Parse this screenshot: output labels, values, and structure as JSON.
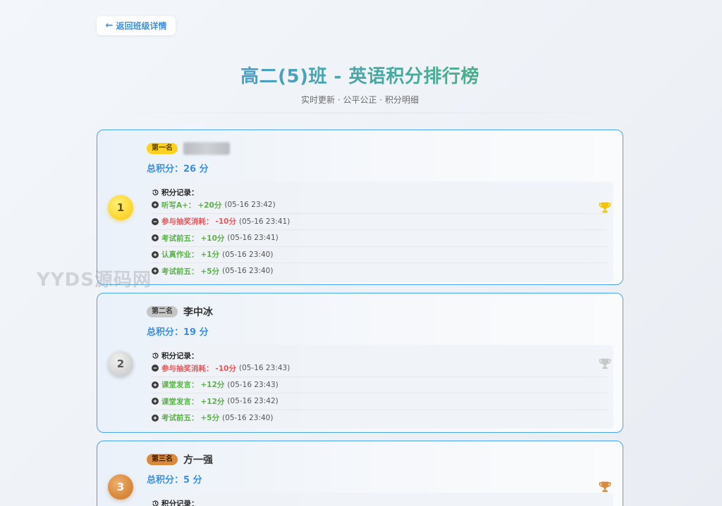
{
  "back_button": {
    "label": "返回班级详情"
  },
  "header": {
    "title": "高二(5)班 - 英语积分排行榜",
    "subtitle": "实时更新 · 公平公正 · 积分明细"
  },
  "colors": {
    "accent_blue": "#3d8fe0",
    "positive_green": "#5bb14a",
    "negative_red": "#e8555a",
    "gold": "#fdd835",
    "silver": "#c5c5c5",
    "bronze": "#d98a3c"
  },
  "ranking": [
    {
      "rank_number": "1",
      "badge": "第一名",
      "name": "",
      "name_blurred": true,
      "total": "总积分：26 分",
      "records_header": "积分记录：",
      "trophy_icon": "trophy-gold-icon",
      "records": [
        {
          "label": "听写A+：",
          "points": "+20分",
          "time": "(05-16 23:42)",
          "type": "positive"
        },
        {
          "label": "参与抽奖消耗：",
          "points": "-10分",
          "time": "(05-16 23:41)",
          "type": "negative"
        },
        {
          "label": "考试前五：",
          "points": "+10分",
          "time": "(05-16 23:41)",
          "type": "positive"
        },
        {
          "label": "认真作业：",
          "points": "+1分",
          "time": "(05-16 23:40)",
          "type": "positive"
        },
        {
          "label": "考试前五：",
          "points": "+5分",
          "time": "(05-16 23:40)",
          "type": "positive"
        }
      ]
    },
    {
      "rank_number": "2",
      "badge": "第二名",
      "name": "李中冰",
      "name_blurred": false,
      "total": "总积分：19 分",
      "records_header": "积分记录：",
      "trophy_icon": "trophy-silver-icon",
      "records": [
        {
          "label": "参与抽奖消耗：",
          "points": "-10分",
          "time": "(05-16 23:43)",
          "type": "negative"
        },
        {
          "label": "课堂发言：",
          "points": "+12分",
          "time": "(05-16 23:43)",
          "type": "positive"
        },
        {
          "label": "课堂发言：",
          "points": "+12分",
          "time": "(05-16 23:42)",
          "type": "positive"
        },
        {
          "label": "考试前五：",
          "points": "+5分",
          "time": "(05-16 23:40)",
          "type": "positive"
        }
      ]
    },
    {
      "rank_number": "3",
      "badge": "第三名",
      "name": "方一强",
      "name_blurred": false,
      "total": "总积分：5 分",
      "records_header": "积分记录：",
      "trophy_icon": "trophy-bronze-icon",
      "records": []
    }
  ],
  "watermark": "YYDS源码网"
}
